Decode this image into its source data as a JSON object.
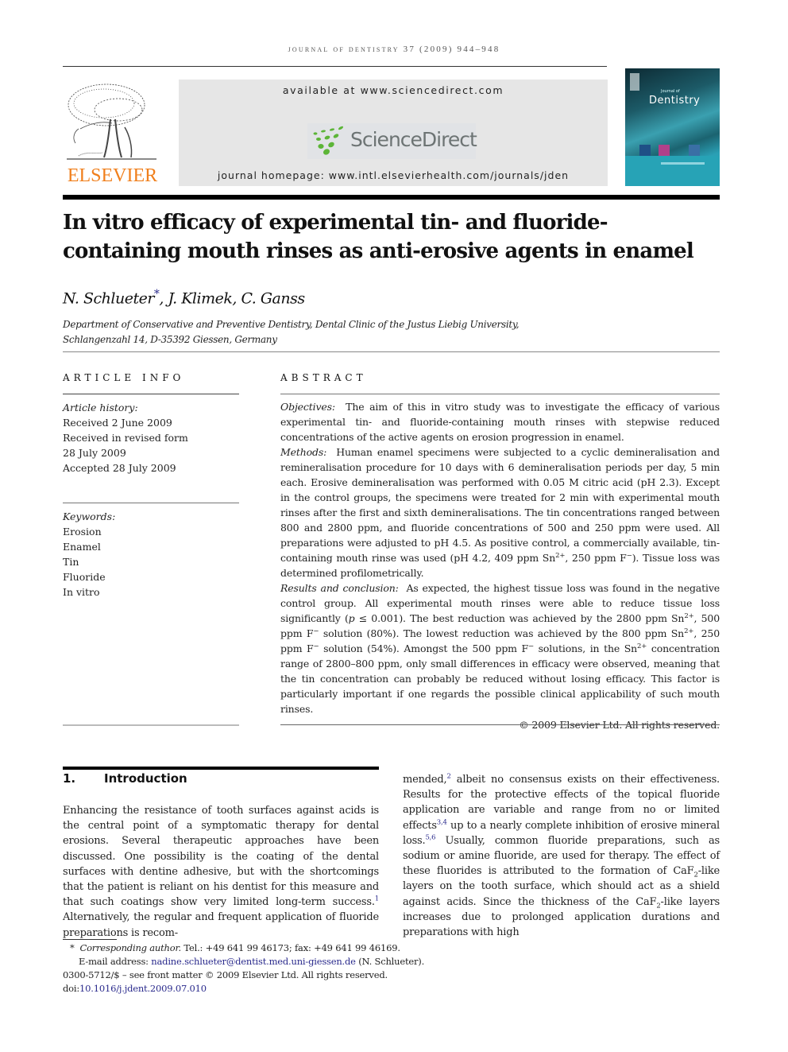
{
  "running_head": "journal of dentistry 37 (2009) 944–948",
  "header": {
    "publisher_logo": "ELSEVIER",
    "available_at": "available at www.sciencedirect.com",
    "sciencedirect_logo": "ScienceDirect",
    "journal_homepage": "journal homepage: www.intl.elsevierhealth.com/journals/jden",
    "cover_title": "Dentistry",
    "cover_subtitle": "Journal of",
    "colors": {
      "elsevier_orange": "#f07f1c",
      "sd_green": "#5cb537",
      "sd_gray": "#6d7474",
      "banner_gray": "#e6e6e6",
      "cover_teal": "#27a3b6",
      "link_blue": "#2a2a8c"
    }
  },
  "article": {
    "title": "In vitro efficacy of experimental tin- and fluoride-containing mouth rinses as anti-erosive agents in enamel",
    "authors": [
      {
        "name": "N. Schlueter",
        "corresponding_mark": "*"
      },
      {
        "name": "J. Klimek"
      },
      {
        "name": "C. Ganss"
      }
    ],
    "author_sep": ", ",
    "affiliation_line1": "Department of Conservative and Preventive Dentistry, Dental Clinic of the Justus Liebig University,",
    "affiliation_line2": "Schlangenzahl 14, D-35392 Giessen, Germany"
  },
  "article_info": {
    "label": "ARTICLE INFO",
    "history_label": "Article history:",
    "history": [
      "Received 2 June 2009",
      "Received in revised form",
      "28 July 2009",
      "Accepted 28 July 2009"
    ],
    "keywords_label": "Keywords:",
    "keywords": [
      "Erosion",
      "Enamel",
      "Tin",
      "Fluoride",
      "In vitro"
    ]
  },
  "abstract": {
    "label": "ABSTRACT",
    "objectives_label": "Objectives:",
    "objectives": "The aim of this in vitro study was to investigate the efficacy of various experimental tin- and fluoride-containing mouth rinses with stepwise reduced concentrations of the active agents on erosion progression in enamel.",
    "methods_label": "Methods:",
    "methods_a": "Human enamel specimens were subjected to a cyclic demineralisation and remineralisation procedure for 10 days with 6 demineralisation periods per day, 5 min each. Erosive demineralisation was performed with 0.05 M citric acid (pH 2.3). Except in the control groups, the specimens were treated for 2 min with experimental mouth rinses after the first and sixth demineralisations. The tin concentrations ranged between 800 and 2800 ppm, and fluoride concentrations of 500 and 250 ppm were used. All preparations were adjusted to pH 4.5. As positive control, a commercially available, tin-containing mouth rinse was used (pH 4.2, 409 ppm Sn",
    "methods_sup1": "2+",
    "methods_b": ", 250 ppm F",
    "methods_sup2": "−",
    "methods_c": "). Tissue loss was determined profilometrically.",
    "results_label": "Results and conclusion:",
    "results_a": "As expected, the highest tissue loss was found in the negative control group. All experimental mouth rinses were able to reduce tissue loss significantly (",
    "results_p": "p",
    "results_b": " ≤ 0.001). The best reduction was achieved by the 2800 ppm Sn",
    "results_c": ", 500 ppm F",
    "results_d": " solution (80%). The lowest reduction was achieved by the 800 ppm Sn",
    "results_e": ", 250 ppm F",
    "results_f": " solution (54%). Amongst the 500 ppm F",
    "results_g": " solutions, in the Sn",
    "results_h": " concentration range of 2800–800 ppm, only small differences in efficacy were observed, meaning that the tin concentration can probably be reduced without losing efficacy. This factor is particularly important if one regards the possible clinical applicability of such mouth rinses.",
    "sup_sn": "2+",
    "sup_f": "−",
    "copyright": "© 2009 Elsevier Ltd. All rights reserved."
  },
  "intro": {
    "number": "1.",
    "heading": "Introduction",
    "left_a": "Enhancing the resistance of tooth surfaces against acids is the central point of a symptomatic therapy for dental erosions. Several therapeutic approaches have been discussed. One possibility is the coating of the dental surfaces with dentine adhesive, but with the shortcomings that the patient is reliant on his dentist for this measure and that such coatings show very limited long-term success.",
    "ref1": "1",
    "left_b": " Alternatively, the regular and frequent application of fluoride preparations is recom-",
    "right_a": "mended,",
    "ref2": "2",
    "right_b": " albeit no consensus exists on their effectiveness. Results for the protective effects of the topical fluoride application are variable and range from no or limited effects",
    "ref34": "3,4",
    "right_c": " up to a nearly complete inhibition of erosive mineral loss.",
    "ref56": "5,6",
    "right_d": " Usually, common fluoride preparations, such as sodium or amine fluoride, are used for therapy. The effect of these fluorides is attributed to the formation of CaF",
    "sub2": "2",
    "right_e": "-like layers on the tooth surface, which should act as a shield against acids. Since the thickness of the CaF",
    "right_f": "-like layers increases due to prolonged application durations and preparations with high"
  },
  "footnotes": {
    "star": "*",
    "corresponding_label": "Corresponding author.",
    "contact": " Tel.: +49 641 99 46173; fax: +49 641 99 46169.",
    "email_label": "E-mail address: ",
    "email": "nadine.schlueter@dentist.med.uni-giessen.de",
    "email_suffix": " (N. Schlueter).",
    "issn_line": "0300-5712/$ – see front matter © 2009 Elsevier Ltd. All rights reserved.",
    "doi_label": "doi:",
    "doi": "10.1016/j.jdent.2009.07.010"
  }
}
